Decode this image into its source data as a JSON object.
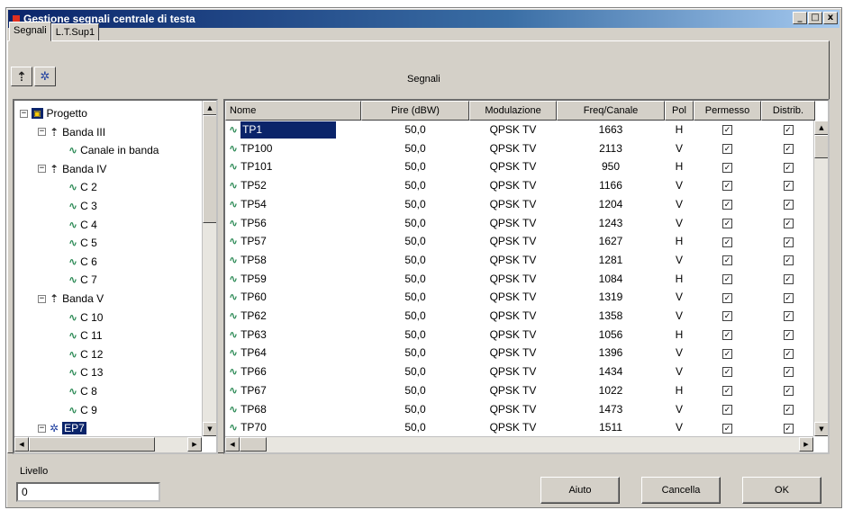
{
  "window": {
    "title": "Gestione segnali centrale di testa",
    "controls": [
      "_",
      "□",
      "x"
    ]
  },
  "tabs": [
    {
      "label": "Segnali",
      "active": true
    },
    {
      "label": "L.T.Sup1",
      "active": false
    }
  ],
  "toolbar": {
    "buttons": [
      "add-band-icon",
      "add-signal-icon"
    ]
  },
  "section_label": "Segnali",
  "tree": {
    "items": [
      {
        "label": "Progetto",
        "level": 0,
        "icon": "project-icon",
        "expander": "−"
      },
      {
        "label": "Banda III",
        "level": 1,
        "icon": "band-icon",
        "expander": "−"
      },
      {
        "label": "Canale in banda",
        "level": 2,
        "icon": "signal-icon"
      },
      {
        "label": "Banda IV",
        "level": 1,
        "icon": "band-icon",
        "expander": "−"
      },
      {
        "label": "C 2",
        "level": 2,
        "icon": "signal-icon"
      },
      {
        "label": "C 3",
        "level": 2,
        "icon": "signal-icon"
      },
      {
        "label": "C 4",
        "level": 2,
        "icon": "signal-icon"
      },
      {
        "label": "C 5",
        "level": 2,
        "icon": "signal-icon"
      },
      {
        "label": "C 6",
        "level": 2,
        "icon": "signal-icon"
      },
      {
        "label": "C 7",
        "level": 2,
        "icon": "signal-icon"
      },
      {
        "label": "Banda V",
        "level": 1,
        "icon": "band-icon",
        "expander": "−"
      },
      {
        "label": "C 10",
        "level": 2,
        "icon": "signal-icon"
      },
      {
        "label": "C 11",
        "level": 2,
        "icon": "signal-icon"
      },
      {
        "label": "C 12",
        "level": 2,
        "icon": "signal-icon"
      },
      {
        "label": "C 13",
        "level": 2,
        "icon": "signal-icon"
      },
      {
        "label": "C 8",
        "level": 2,
        "icon": "signal-icon"
      },
      {
        "label": "C 9",
        "level": 2,
        "icon": "signal-icon"
      },
      {
        "label": "EP7",
        "level": 1,
        "icon": "satellite-icon",
        "expander": "−",
        "selected": true
      }
    ]
  },
  "grid": {
    "columns": [
      "Nome",
      "Pire (dBW)",
      "Modulazione",
      "Freq/Canale",
      "Pol",
      "Permesso",
      "Distrib."
    ],
    "rows": [
      {
        "name": "TP1",
        "pire": "50,0",
        "mod": "QPSK TV",
        "freq": "1663",
        "pol": "H",
        "selected": true
      },
      {
        "name": "TP100",
        "pire": "50,0",
        "mod": "QPSK TV",
        "freq": "2113",
        "pol": "V"
      },
      {
        "name": "TP101",
        "pire": "50,0",
        "mod": "QPSK TV",
        "freq": "950",
        "pol": "H"
      },
      {
        "name": "TP52",
        "pire": "50,0",
        "mod": "QPSK TV",
        "freq": "1166",
        "pol": "V"
      },
      {
        "name": "TP54",
        "pire": "50,0",
        "mod": "QPSK TV",
        "freq": "1204",
        "pol": "V"
      },
      {
        "name": "TP56",
        "pire": "50,0",
        "mod": "QPSK TV",
        "freq": "1243",
        "pol": "V"
      },
      {
        "name": "TP57",
        "pire": "50,0",
        "mod": "QPSK TV",
        "freq": "1627",
        "pol": "H"
      },
      {
        "name": "TP58",
        "pire": "50,0",
        "mod": "QPSK TV",
        "freq": "1281",
        "pol": "V"
      },
      {
        "name": "TP59",
        "pire": "50,0",
        "mod": "QPSK TV",
        "freq": "1084",
        "pol": "H"
      },
      {
        "name": "TP60",
        "pire": "50,0",
        "mod": "QPSK TV",
        "freq": "1319",
        "pol": "V"
      },
      {
        "name": "TP62",
        "pire": "50,0",
        "mod": "QPSK TV",
        "freq": "1358",
        "pol": "V"
      },
      {
        "name": "TP63",
        "pire": "50,0",
        "mod": "QPSK TV",
        "freq": "1056",
        "pol": "H"
      },
      {
        "name": "TP64",
        "pire": "50,0",
        "mod": "QPSK TV",
        "freq": "1396",
        "pol": "V"
      },
      {
        "name": "TP66",
        "pire": "50,0",
        "mod": "QPSK TV",
        "freq": "1434",
        "pol": "V"
      },
      {
        "name": "TP67",
        "pire": "50,0",
        "mod": "QPSK TV",
        "freq": "1022",
        "pol": "H"
      },
      {
        "name": "TP68",
        "pire": "50,0",
        "mod": "QPSK TV",
        "freq": "1473",
        "pol": "V"
      },
      {
        "name": "TP70",
        "pire": "50,0",
        "mod": "QPSK TV",
        "freq": "1511",
        "pol": "V"
      }
    ]
  },
  "footer": {
    "livello_label": "Livello",
    "livello_value": "0",
    "buttons": {
      "help": "Aiuto",
      "cancel": "Cancella",
      "ok": "OK"
    }
  },
  "colors": {
    "selection": "#0a246a",
    "face": "#d4d0c8",
    "signal_icon": "#2e8b57"
  }
}
